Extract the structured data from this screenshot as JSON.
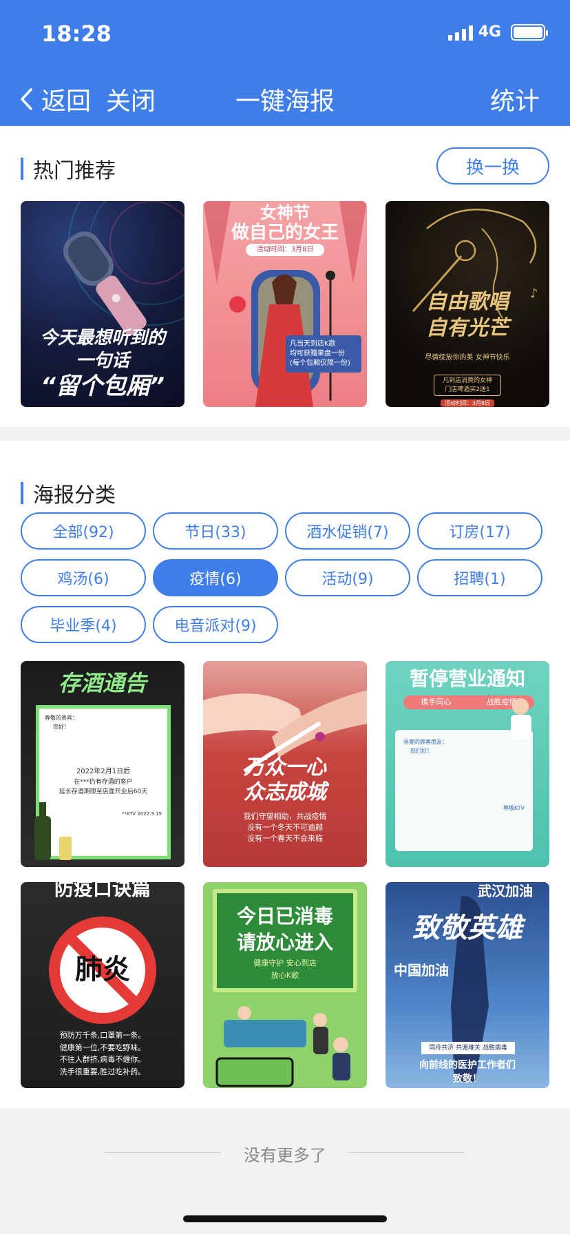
{
  "status": {
    "time": "18:28",
    "network": "4G"
  },
  "nav": {
    "back_label": "返回",
    "close_label": "关闭",
    "title": "一键海报",
    "stats_label": "统计"
  },
  "hot": {
    "title": "热门推荐",
    "swap_label": "换一换",
    "posters": [
      {
        "line1": "今天最想听到的",
        "line2": "一句话",
        "line3": "“留个包厢”"
      },
      {
        "line1": "女神节",
        "line2": "做自己的女王",
        "date": "活动时间：3月8日",
        "note1": "凡当天到店K歌",
        "note2": "均可获赠果盘一份",
        "note3": "(每个包厢仅限一份)"
      },
      {
        "line1": "自由歌唱",
        "line2": "自有光芒",
        "sub": "尽情绽放你的美  女神节快乐",
        "note1": "凡到店消费的女神",
        "note2": "门店啤酒买2送1",
        "date": "活动时间：3月8日"
      }
    ]
  },
  "category": {
    "title": "海报分类",
    "chips": [
      {
        "label": "全部(92)",
        "active": false
      },
      {
        "label": "节日(33)",
        "active": false
      },
      {
        "label": "酒水促销(7)",
        "active": false
      },
      {
        "label": "订房(17)",
        "active": false
      },
      {
        "label": "鸡汤(6)",
        "active": false
      },
      {
        "label": "疫情(6)",
        "active": true
      },
      {
        "label": "活动(9)",
        "active": false
      },
      {
        "label": "招聘(1)",
        "active": false
      },
      {
        "label": "毕业季(4)",
        "active": false
      },
      {
        "label": "电音派对(9)",
        "active": false
      }
    ],
    "posters": [
      {
        "title": "存酒通告",
        "body1": "尊敬的贵宾：",
        "body2": "您好！",
        "date": "2022年2月1日后",
        "body3": "在***仍有存酒的客户",
        "body4": "延长存酒期限至店面开业后60天",
        "sign": "**KTV 2022.3.15"
      },
      {
        "title1": "万众一心",
        "title2": "众志成城",
        "body1": "我们守望相助，共战疫情",
        "body2": "没有一个冬天不可逾越",
        "body3": "没有一个春天不会来临"
      },
      {
        "title": "暂停营业通知",
        "sub1": "携手同心",
        "sub2": "战胜疫情",
        "body1": "亲爱的顾客朋友：",
        "body2": "您们好！",
        "sign": "尊敬KTV"
      },
      {
        "title": "防疫口诀篇",
        "mark": "肺炎",
        "line1": "预防万千条,口罩第一条。",
        "line2": "健康第一位,不要吃野味。",
        "line3": "不往人群挤,病毒不缠你。",
        "line4": "洗手很重要,胜过吃补药。"
      },
      {
        "title1": "今日已消毒",
        "title2": "请放心进入",
        "sub1": "健康守护  安心到店",
        "sub2": "放心K歌"
      },
      {
        "top": "武汉加油",
        "big": "致敬英雄",
        "mid": "中国加油",
        "box": "同舟共济 共渡难关 战胜病毒",
        "bottom1": "向前线的医护工作者们",
        "bottom2": "致敬！"
      }
    ]
  },
  "footer": {
    "text": "没有更多了"
  }
}
